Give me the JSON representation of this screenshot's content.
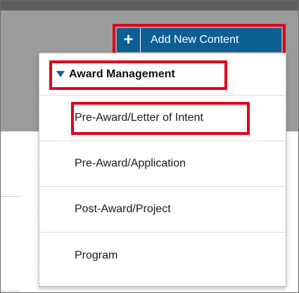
{
  "toolbar": {
    "add_button_label": "Add New Content",
    "add_button_icon": "plus-icon"
  },
  "dropdown": {
    "section_title": "Award Management",
    "items": [
      {
        "label": "Pre-Award/Letter of Intent"
      },
      {
        "label": "Pre-Award/Application"
      },
      {
        "label": "Post-Award/Project"
      },
      {
        "label": "Program"
      }
    ]
  },
  "colors": {
    "button_blue": "#0b5f94",
    "highlight_red": "#e0001b",
    "header_gray": "#9b9b9b",
    "caret_blue": "#1a5fa0"
  }
}
